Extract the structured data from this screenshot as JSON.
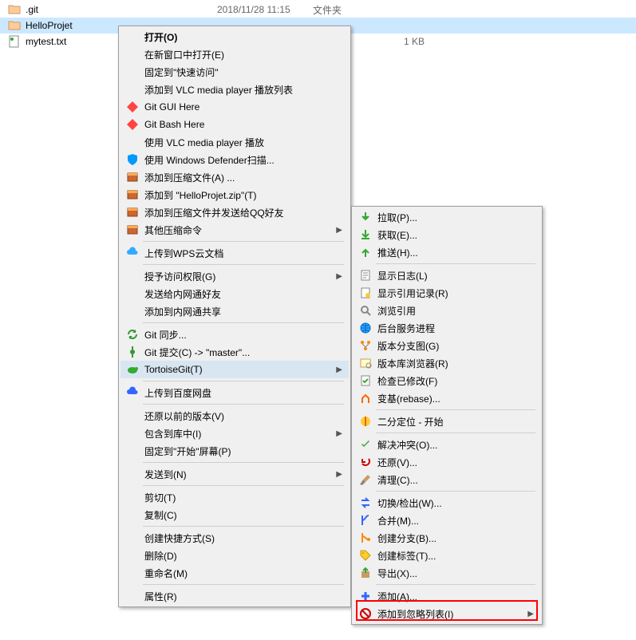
{
  "files": [
    {
      "name": ".git",
      "date": "2018/11/28 11:15",
      "type": "文件夹",
      "size": ""
    },
    {
      "name": "HelloProjet",
      "date": "",
      "type": "",
      "size": ""
    },
    {
      "name": "mytest.txt",
      "date": "",
      "type": "",
      "size": "1 KB"
    }
  ],
  "menu1": {
    "open": "打开(O)",
    "open_new": "在新窗口中打开(E)",
    "pin_quick": "固定到\"快速访问\"",
    "vlc_add": "添加到 VLC media player 播放列表",
    "git_gui": "Git GUI Here",
    "git_bash": "Git Bash Here",
    "vlc_play": "使用 VLC media player 播放",
    "defender": "使用 Windows Defender扫描...",
    "compress_a": "添加到压缩文件(A) ...",
    "compress_zip": "添加到 \"HelloProjet.zip\"(T)",
    "compress_qq": "添加到压缩文件并发送给QQ好友",
    "compress_other": "其他压缩命令",
    "wps": "上传到WPS云文档",
    "grant": "授予访问权限(G)",
    "netcom": "发送给内网通好友",
    "netshare": "添加到内网通共享",
    "git_sync": "Git 同步...",
    "git_commit": "Git 提交(C) -> \"master\"...",
    "tortoise": "TortoiseGit(T)",
    "baidu": "上传到百度网盘",
    "restore": "还原以前的版本(V)",
    "include": "包含到库中(I)",
    "pin_start": "固定到\"开始\"屏幕(P)",
    "sendto": "发送到(N)",
    "cut": "剪切(T)",
    "copy": "复制(C)",
    "shortcut": "创建快捷方式(S)",
    "delete": "删除(D)",
    "rename": "重命名(M)",
    "props": "属性(R)"
  },
  "menu2": {
    "pull": "拉取(P)...",
    "fetch": "获取(E)...",
    "push": "推送(H)...",
    "log": "显示日志(L)",
    "reflog": "显示引用记录(R)",
    "browse_ref": "浏览引用",
    "daemon": "后台服务进程",
    "revgraph": "版本分支图(G)",
    "repobrowse": "版本库浏览器(R)",
    "checkmod": "检查已修改(F)",
    "rebase": "变基(rebase)...",
    "bisect": "二分定位 - 开始",
    "resolve": "解决冲突(O)...",
    "revert": "还原(V)...",
    "cleanup": "清理(C)...",
    "switch": "切换/检出(W)...",
    "merge": "合并(M)...",
    "branch": "创建分支(B)...",
    "tag": "创建标签(T)...",
    "export": "导出(X)...",
    "add": "添加(A)...",
    "ignore": "添加到忽略列表(I)"
  }
}
